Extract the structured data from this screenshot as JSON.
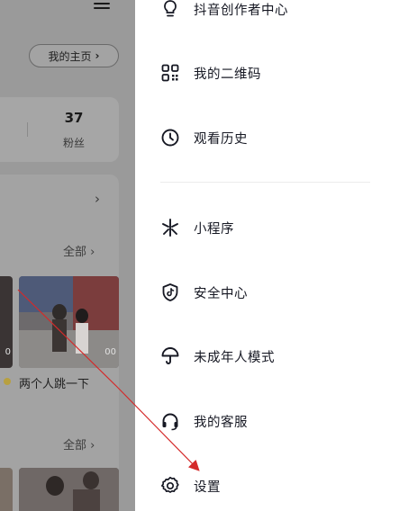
{
  "background_page": {
    "homepage_button": {
      "label": "我的主页",
      "chevron": "›"
    },
    "stats": {
      "followers_count": "37",
      "followers_label": "粉丝"
    },
    "section_chevron": "›",
    "all_link_1": "全部 ›",
    "all_link_2": "全部 ›",
    "video_counts": [
      "0",
      "00"
    ],
    "video_caption": "两个人跳一下"
  },
  "drawer": {
    "items_top": [
      {
        "id": "creator-center",
        "icon": "bulb-icon",
        "label": "抖音创作者中心"
      },
      {
        "id": "qr-code",
        "icon": "qrcode-icon",
        "label": "我的二维码"
      },
      {
        "id": "history",
        "icon": "clock-icon",
        "label": "观看历史"
      }
    ],
    "items_bottom": [
      {
        "id": "mini-program",
        "icon": "asterisk-icon",
        "label": "小程序"
      },
      {
        "id": "security-center",
        "icon": "shield-icon",
        "label": "安全中心"
      },
      {
        "id": "minor-mode",
        "icon": "umbrella-icon",
        "label": "未成年人模式"
      },
      {
        "id": "customer-service",
        "icon": "headset-icon",
        "label": "我的客服"
      },
      {
        "id": "settings",
        "icon": "gear-icon",
        "label": "设置"
      }
    ]
  },
  "colors": {
    "drawer_bg": "#ffffff",
    "overlay_dim": "#9a9a9a",
    "text_primary": "#161823",
    "annotation_arrow": "#d42a2a"
  }
}
